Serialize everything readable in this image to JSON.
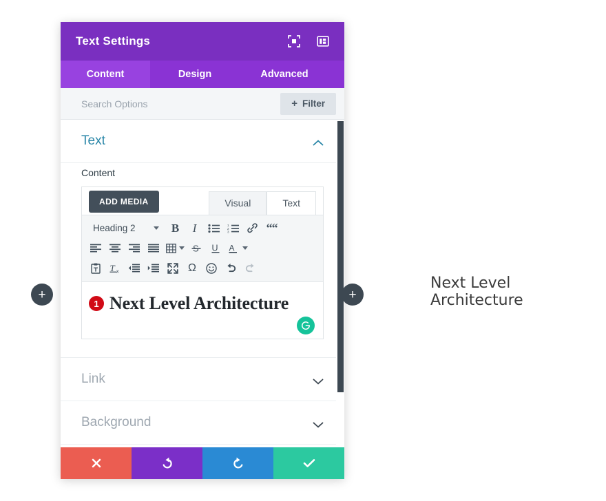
{
  "panel": {
    "title": "Text Settings",
    "header_icons": [
      {
        "name": "focus-frame-icon",
        "label": "Focus"
      },
      {
        "name": "panel-layout-icon",
        "label": "Layout"
      }
    ],
    "tabs": [
      {
        "label": "Content",
        "active": true
      },
      {
        "label": "Design",
        "active": false
      },
      {
        "label": "Advanced",
        "active": false
      }
    ],
    "search": {
      "placeholder": "Search Options",
      "value": ""
    },
    "filter_button": {
      "plus": "+",
      "label": "Filter"
    },
    "sections": [
      {
        "label": "Text",
        "state": "open"
      },
      {
        "label": "Link",
        "state": "closed"
      },
      {
        "label": "Background",
        "state": "closed"
      }
    ],
    "content_section": {
      "field_label": "Content",
      "add_media_label": "ADD MEDIA",
      "editor_tabs": [
        {
          "label": "Visual",
          "active": false
        },
        {
          "label": "Text",
          "active": true
        }
      ],
      "toolbar": {
        "format_select": "Heading 2",
        "row1": [
          {
            "name": "bold-icon",
            "glyph": "B"
          },
          {
            "name": "italic-icon",
            "glyph": "I"
          },
          {
            "name": "bulleted-list-icon",
            "glyph": ""
          },
          {
            "name": "numbered-list-icon",
            "glyph": ""
          },
          {
            "name": "link-icon",
            "glyph": ""
          },
          {
            "name": "blockquote-icon",
            "glyph": ""
          }
        ],
        "row2": [
          {
            "name": "align-left-icon"
          },
          {
            "name": "align-center-icon"
          },
          {
            "name": "align-right-icon"
          },
          {
            "name": "align-justify-icon"
          },
          {
            "name": "table-icon"
          },
          {
            "name": "strikethrough-icon"
          },
          {
            "name": "underline-icon"
          },
          {
            "name": "text-color-icon"
          }
        ],
        "row3": [
          {
            "name": "paste-as-text-icon"
          },
          {
            "name": "clear-formatting-icon"
          },
          {
            "name": "outdent-icon"
          },
          {
            "name": "indent-icon"
          },
          {
            "name": "fullscreen-icon"
          },
          {
            "name": "special-character-icon",
            "glyph": "Ω"
          },
          {
            "name": "emoji-icon"
          },
          {
            "name": "undo-icon"
          },
          {
            "name": "redo-icon"
          }
        ]
      },
      "editor_body": {
        "step_badge": "1",
        "heading_text": "Next Level Architecture",
        "grammarly_glyph": "G"
      }
    },
    "actions": [
      {
        "name": "cancel-button",
        "icon": "close-icon",
        "color": "#eb5d51"
      },
      {
        "name": "undo-button",
        "icon": "undo-icon",
        "color": "#7b2fc8"
      },
      {
        "name": "redo-button",
        "icon": "redo-icon",
        "color": "#2a8ad4"
      },
      {
        "name": "save-button",
        "icon": "check-icon",
        "color": "#2cc9a0"
      }
    ]
  },
  "canvas": {
    "add_left_glyph": "+",
    "add_right_glyph": "+",
    "preview_text": "Next Level Architecture"
  }
}
